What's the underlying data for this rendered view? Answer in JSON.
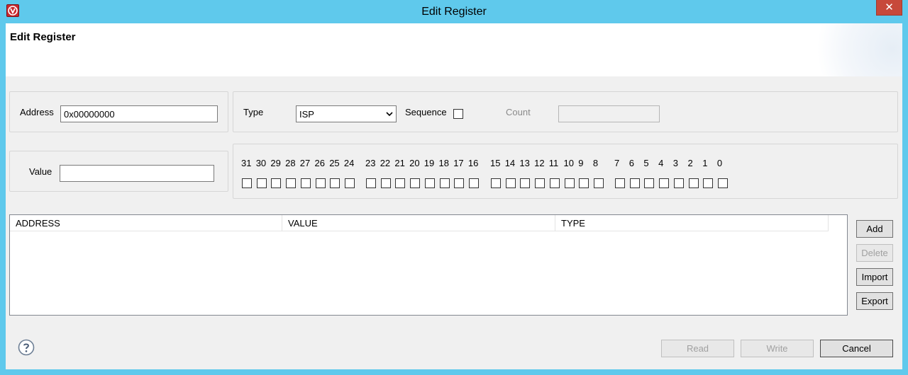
{
  "window": {
    "title": "Edit Register",
    "close_glyph": "✕"
  },
  "header": {
    "title": "Edit Register"
  },
  "address": {
    "label": "Address",
    "value": "0x00000000"
  },
  "type": {
    "label": "Type",
    "selected": "ISP"
  },
  "sequence": {
    "label": "Sequence",
    "checked": false
  },
  "count": {
    "label": "Count",
    "value": ""
  },
  "value_field": {
    "label": "Value",
    "value": ""
  },
  "bits": {
    "numbers": [
      "31",
      "30",
      "29",
      "28",
      "27",
      "26",
      "25",
      "24",
      "23",
      "22",
      "21",
      "20",
      "19",
      "18",
      "17",
      "16",
      "15",
      "14",
      "13",
      "12",
      "11",
      "10",
      "9",
      "8",
      "7",
      "6",
      "5",
      "4",
      "3",
      "2",
      "1",
      "0"
    ]
  },
  "table": {
    "columns": [
      "ADDRESS",
      "VALUE",
      "TYPE"
    ],
    "rows": []
  },
  "side_buttons": {
    "add": "Add",
    "delete": "Delete",
    "import": "Import",
    "export": "Export"
  },
  "footer": {
    "read": "Read",
    "write": "Write",
    "cancel": "Cancel"
  },
  "icons": {
    "app": "app-logo-icon",
    "help": "help-icon",
    "dropdown": "chevron-down-icon"
  },
  "colors": {
    "titlebar": "#5fc9ec",
    "close": "#c7493a",
    "app_icon": "#c8282e"
  }
}
